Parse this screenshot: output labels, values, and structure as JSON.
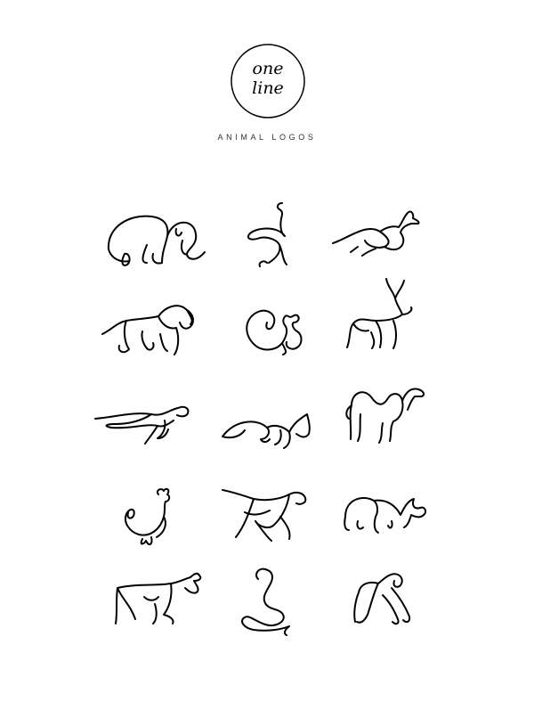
{
  "logo": {
    "line1": "one",
    "line2": "line",
    "alt": "one line logo"
  },
  "subtitle": "ANIMAL LOGOS",
  "animals": [
    "elephant",
    "ostrich",
    "kangaroo",
    "lion",
    "squirrel",
    "deer",
    "cheetah",
    "fox",
    "camel",
    "rooster",
    "horse",
    "rhinoceros",
    "bull",
    "cobra",
    "gorilla"
  ],
  "colors": {
    "background": "#ffffff",
    "ink": "#000000",
    "subtitle": "#333333"
  }
}
